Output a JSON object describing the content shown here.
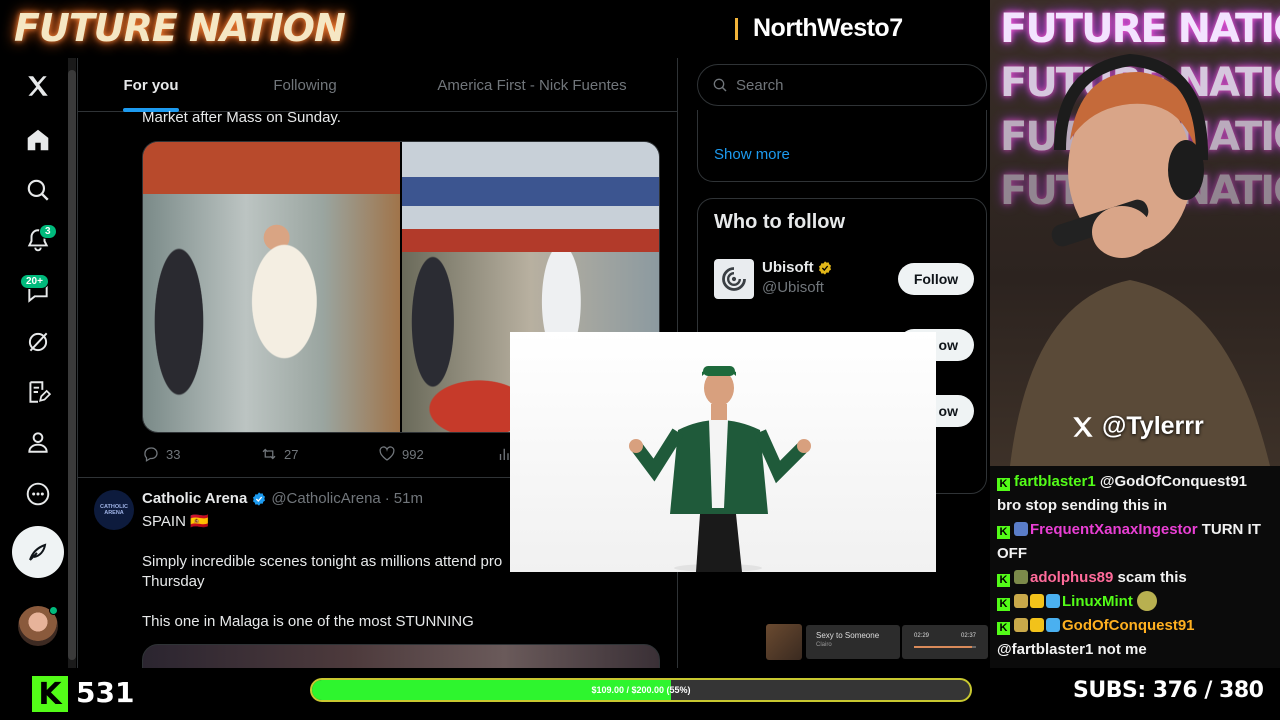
{
  "banner": {
    "brand": "FUTURE NATION",
    "channel": "NorthWesto7"
  },
  "x": {
    "nav": {
      "notifications_badge": "3",
      "messages_badge": "20+"
    },
    "tabs": [
      {
        "label": "For you",
        "active": true
      },
      {
        "label": "Following",
        "active": false
      },
      {
        "label": "America First - Nick Fuentes",
        "active": false
      }
    ],
    "tweet1": {
      "text_tail": "Market after Mass on Sunday.",
      "replies": "33",
      "reposts": "27",
      "likes": "992"
    },
    "tweet2": {
      "avatar_text": "CATHOLIC ARENA",
      "name": "Catholic Arena",
      "handle": "@CatholicArena",
      "time": "51m",
      "line1": "SPAIN 🇪🇸",
      "line2": "Simply incredible scenes tonight as millions attend pro",
      "line3": "Thursday",
      "line4": "This one in Malaga is one of the most STUNNING"
    },
    "search": {
      "placeholder": "Search"
    },
    "trends": {
      "show_more": "Show more"
    },
    "who_to_follow": {
      "title": "Who to follow",
      "accounts": [
        {
          "name": "Ubisoft",
          "handle": "@Ubisoft",
          "button": "Follow"
        },
        {
          "button_partial": "ow"
        },
        {
          "button_partial": "ow"
        }
      ]
    }
  },
  "music": {
    "title": "Sexy to Someone",
    "artist": "Clairo",
    "elapsed": "02:29",
    "total": "02:37",
    "progress": 0.94
  },
  "webcam": {
    "neon": "FUTURE NATION",
    "handle": "@Tylerrr"
  },
  "chat": {
    "messages": [
      {
        "user": "fartblaster1",
        "text": "@GodOfConquest91 bro stop sending this in"
      },
      {
        "user": "FrequentXanaxIngestor",
        "text": "TURN IT OFF"
      },
      {
        "user": "adolphus89",
        "text": "scam this"
      },
      {
        "user": "LinuxMint",
        "text": ""
      },
      {
        "user": "GodOfConquest91",
        "text": "@fartblaster1 not me"
      }
    ]
  },
  "footer": {
    "viewers": "531",
    "goal_text": "$109.00 / $200.00 (55%)",
    "goal_fraction": 0.545,
    "subs": "SUBS:  376 / 380"
  },
  "colors": {
    "x_blue": "#1d9bf0",
    "kick_green": "#53fc18",
    "verified_gold": "#e2b719"
  }
}
